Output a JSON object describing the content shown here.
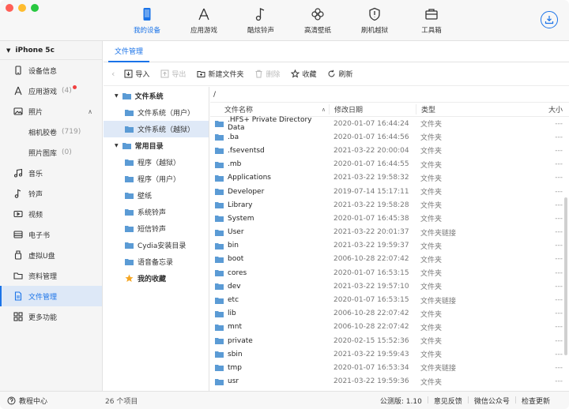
{
  "nav": {
    "items": [
      {
        "label": "我的设备",
        "icon": "phone-icon",
        "active": true
      },
      {
        "label": "应用游戏",
        "icon": "app-store-icon",
        "active": false
      },
      {
        "label": "酷炫铃声",
        "icon": "music-note-icon",
        "active": false
      },
      {
        "label": "高清壁纸",
        "icon": "flower-icon",
        "active": false
      },
      {
        "label": "刷机越狱",
        "icon": "shield-icon",
        "active": false
      },
      {
        "label": "工具箱",
        "icon": "toolbox-icon",
        "active": false
      }
    ],
    "download_icon": "download-icon"
  },
  "sidebar": {
    "device_name": "iPhone 5c",
    "items": [
      {
        "label": "设备信息",
        "icon": "device-info-icon"
      },
      {
        "label": "应用游戏",
        "count": "(4)",
        "icon": "app-icon"
      },
      {
        "label": "照片",
        "icon": "photo-icon"
      },
      {
        "label": "相机胶卷",
        "count": "(719)"
      },
      {
        "label": "照片图库",
        "count": "(0)"
      },
      {
        "label": "音乐",
        "icon": "music-icon"
      },
      {
        "label": "铃声",
        "icon": "ringtone-icon"
      },
      {
        "label": "视频",
        "icon": "video-icon"
      },
      {
        "label": "电子书",
        "icon": "ebook-icon"
      },
      {
        "label": "虚拟U盘",
        "icon": "usb-icon"
      },
      {
        "label": "资料管理",
        "icon": "folder-icon"
      },
      {
        "label": "文件管理",
        "icon": "file-icon",
        "active": true
      },
      {
        "label": "更多功能",
        "icon": "grid-icon"
      }
    ]
  },
  "main": {
    "tab": "文件管理",
    "toolbar": {
      "import": "导入",
      "export": "导出",
      "new_folder": "新建文件夹",
      "delete": "删除",
      "favorite": "收藏",
      "refresh": "刷新"
    },
    "tree": {
      "group1": "文件系统",
      "group1_items": [
        "文件系统（用户）",
        "文件系统（越狱）"
      ],
      "group2": "常用目录",
      "group2_items": [
        "程序（越狱）",
        "程序（用户）",
        "壁纸",
        "系统铃声",
        "短信铃声",
        "Cydia安装目录",
        "语音备忘录"
      ],
      "favorites": "我的收藏"
    },
    "path": "/",
    "columns": {
      "name": "文件名称",
      "date": "修改日期",
      "type": "类型",
      "size": "大小"
    },
    "rows": [
      {
        "name": ".HFS+ Private Directory Data",
        "date": "2020-01-07 16:44:24",
        "type": "文件夹",
        "size": "---"
      },
      {
        "name": ".ba",
        "date": "2020-01-07 16:44:56",
        "type": "文件夹",
        "size": "---"
      },
      {
        "name": ".fseventsd",
        "date": "2021-03-22 20:00:04",
        "type": "文件夹",
        "size": "---"
      },
      {
        "name": ".mb",
        "date": "2020-01-07 16:44:55",
        "type": "文件夹",
        "size": "---"
      },
      {
        "name": "Applications",
        "date": "2021-03-22 19:58:32",
        "type": "文件夹",
        "size": "---"
      },
      {
        "name": "Developer",
        "date": "2019-07-14 15:17:11",
        "type": "文件夹",
        "size": "---"
      },
      {
        "name": "Library",
        "date": "2021-03-22 19:58:28",
        "type": "文件夹",
        "size": "---"
      },
      {
        "name": "System",
        "date": "2020-01-07 16:45:38",
        "type": "文件夹",
        "size": "---"
      },
      {
        "name": "User",
        "date": "2021-03-22 20:01:37",
        "type": "文件夹链接",
        "size": "---"
      },
      {
        "name": "bin",
        "date": "2021-03-22 19:59:37",
        "type": "文件夹",
        "size": "---"
      },
      {
        "name": "boot",
        "date": "2006-10-28 22:07:42",
        "type": "文件夹",
        "size": "---"
      },
      {
        "name": "cores",
        "date": "2020-01-07 16:53:15",
        "type": "文件夹",
        "size": "---"
      },
      {
        "name": "dev",
        "date": "2021-03-22 19:57:10",
        "type": "文件夹",
        "size": "---"
      },
      {
        "name": "etc",
        "date": "2020-01-07 16:53:15",
        "type": "文件夹链接",
        "size": "---"
      },
      {
        "name": "lib",
        "date": "2006-10-28 22:07:42",
        "type": "文件夹",
        "size": "---"
      },
      {
        "name": "mnt",
        "date": "2006-10-28 22:07:42",
        "type": "文件夹",
        "size": "---"
      },
      {
        "name": "private",
        "date": "2020-02-15 15:52:36",
        "type": "文件夹",
        "size": "---"
      },
      {
        "name": "sbin",
        "date": "2021-03-22 19:59:43",
        "type": "文件夹",
        "size": "---"
      },
      {
        "name": "tmp",
        "date": "2020-01-07 16:53:34",
        "type": "文件夹链接",
        "size": "---"
      },
      {
        "name": "usr",
        "date": "2021-03-22 19:59:36",
        "type": "文件夹",
        "size": "---"
      }
    ]
  },
  "status": {
    "help": "教程中心",
    "items": "26 个项目",
    "version": "公测版: 1.10",
    "feedback": "意见反馈",
    "wechat": "微信公众号",
    "update": "检查更新"
  },
  "colors": {
    "accent": "#1a73e8",
    "folder": "#5b9bd5",
    "star": "#f5a623",
    "red": "#ff5f57",
    "yellow": "#febc2e",
    "green": "#28c840"
  }
}
